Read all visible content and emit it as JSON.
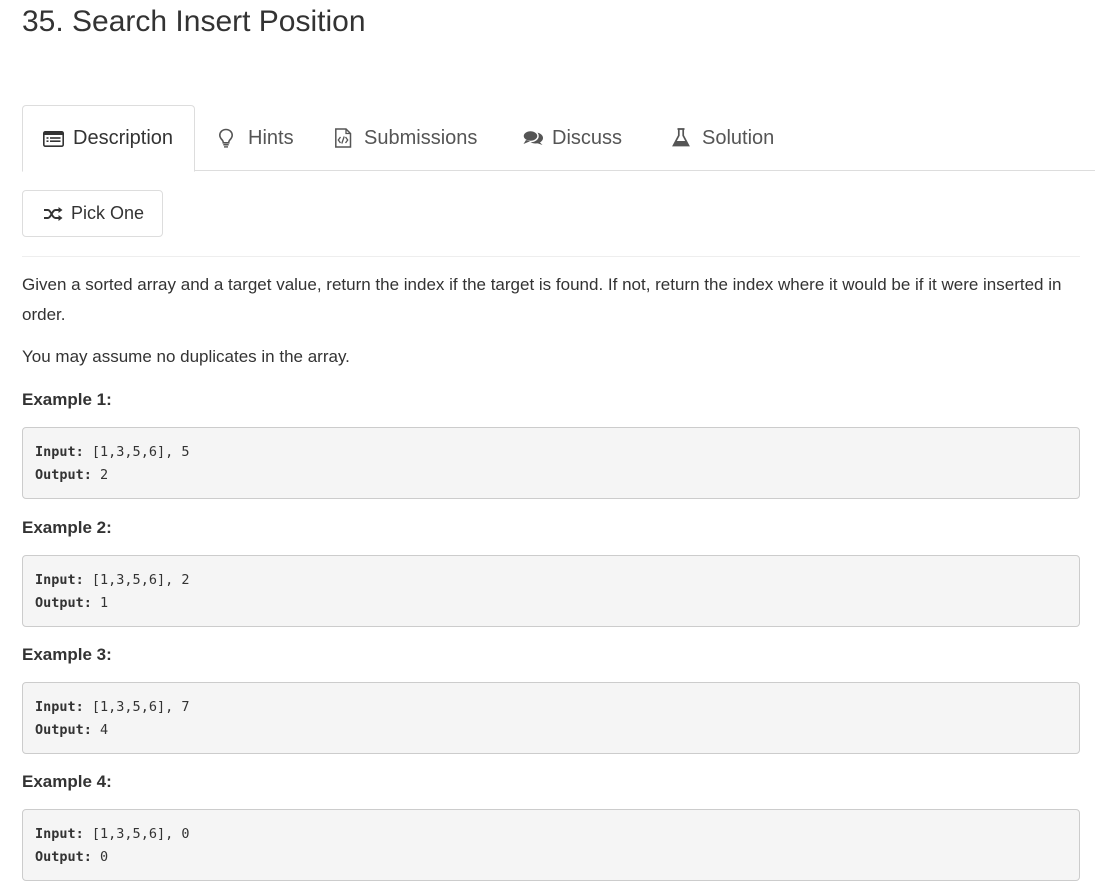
{
  "problem": {
    "title": "35. Search Insert Position"
  },
  "tabs": [
    {
      "label": "Description",
      "icon": "description-icon",
      "active": true
    },
    {
      "label": "Hints",
      "icon": "lightbulb-icon"
    },
    {
      "label": "Submissions",
      "icon": "code-file-icon"
    },
    {
      "label": "Discuss",
      "icon": "comments-icon"
    },
    {
      "label": "Solution",
      "icon": "flask-icon"
    }
  ],
  "pick_one": {
    "label": "Pick One",
    "icon": "shuffle-icon"
  },
  "description": {
    "paragraph1": "Given a sorted array and a target value, return the index if the target is found. If not, return the index where it would be if it were inserted in order.",
    "paragraph2": "You may assume no duplicates in the array."
  },
  "examples": [
    {
      "heading": "Example 1:",
      "input_label": "Input:",
      "input_value": "[1,3,5,6], 5",
      "output_label": "Output:",
      "output_value": "2"
    },
    {
      "heading": "Example 2:",
      "input_label": "Input:",
      "input_value": "[1,3,5,6], 2",
      "output_label": "Output:",
      "output_value": "1"
    },
    {
      "heading": "Example 3:",
      "input_label": "Input:",
      "input_value": "[1,3,5,6], 7",
      "output_label": "Output:",
      "output_value": "4"
    },
    {
      "heading": "Example 4:",
      "input_label": "Input:",
      "input_value": "[1,3,5,6], 0",
      "output_label": "Output:",
      "output_value": "0"
    }
  ],
  "colors": {
    "text": "#333333",
    "tab_text": "#555555",
    "border": "#dddddd",
    "code_bg": "#f5f5f5"
  }
}
